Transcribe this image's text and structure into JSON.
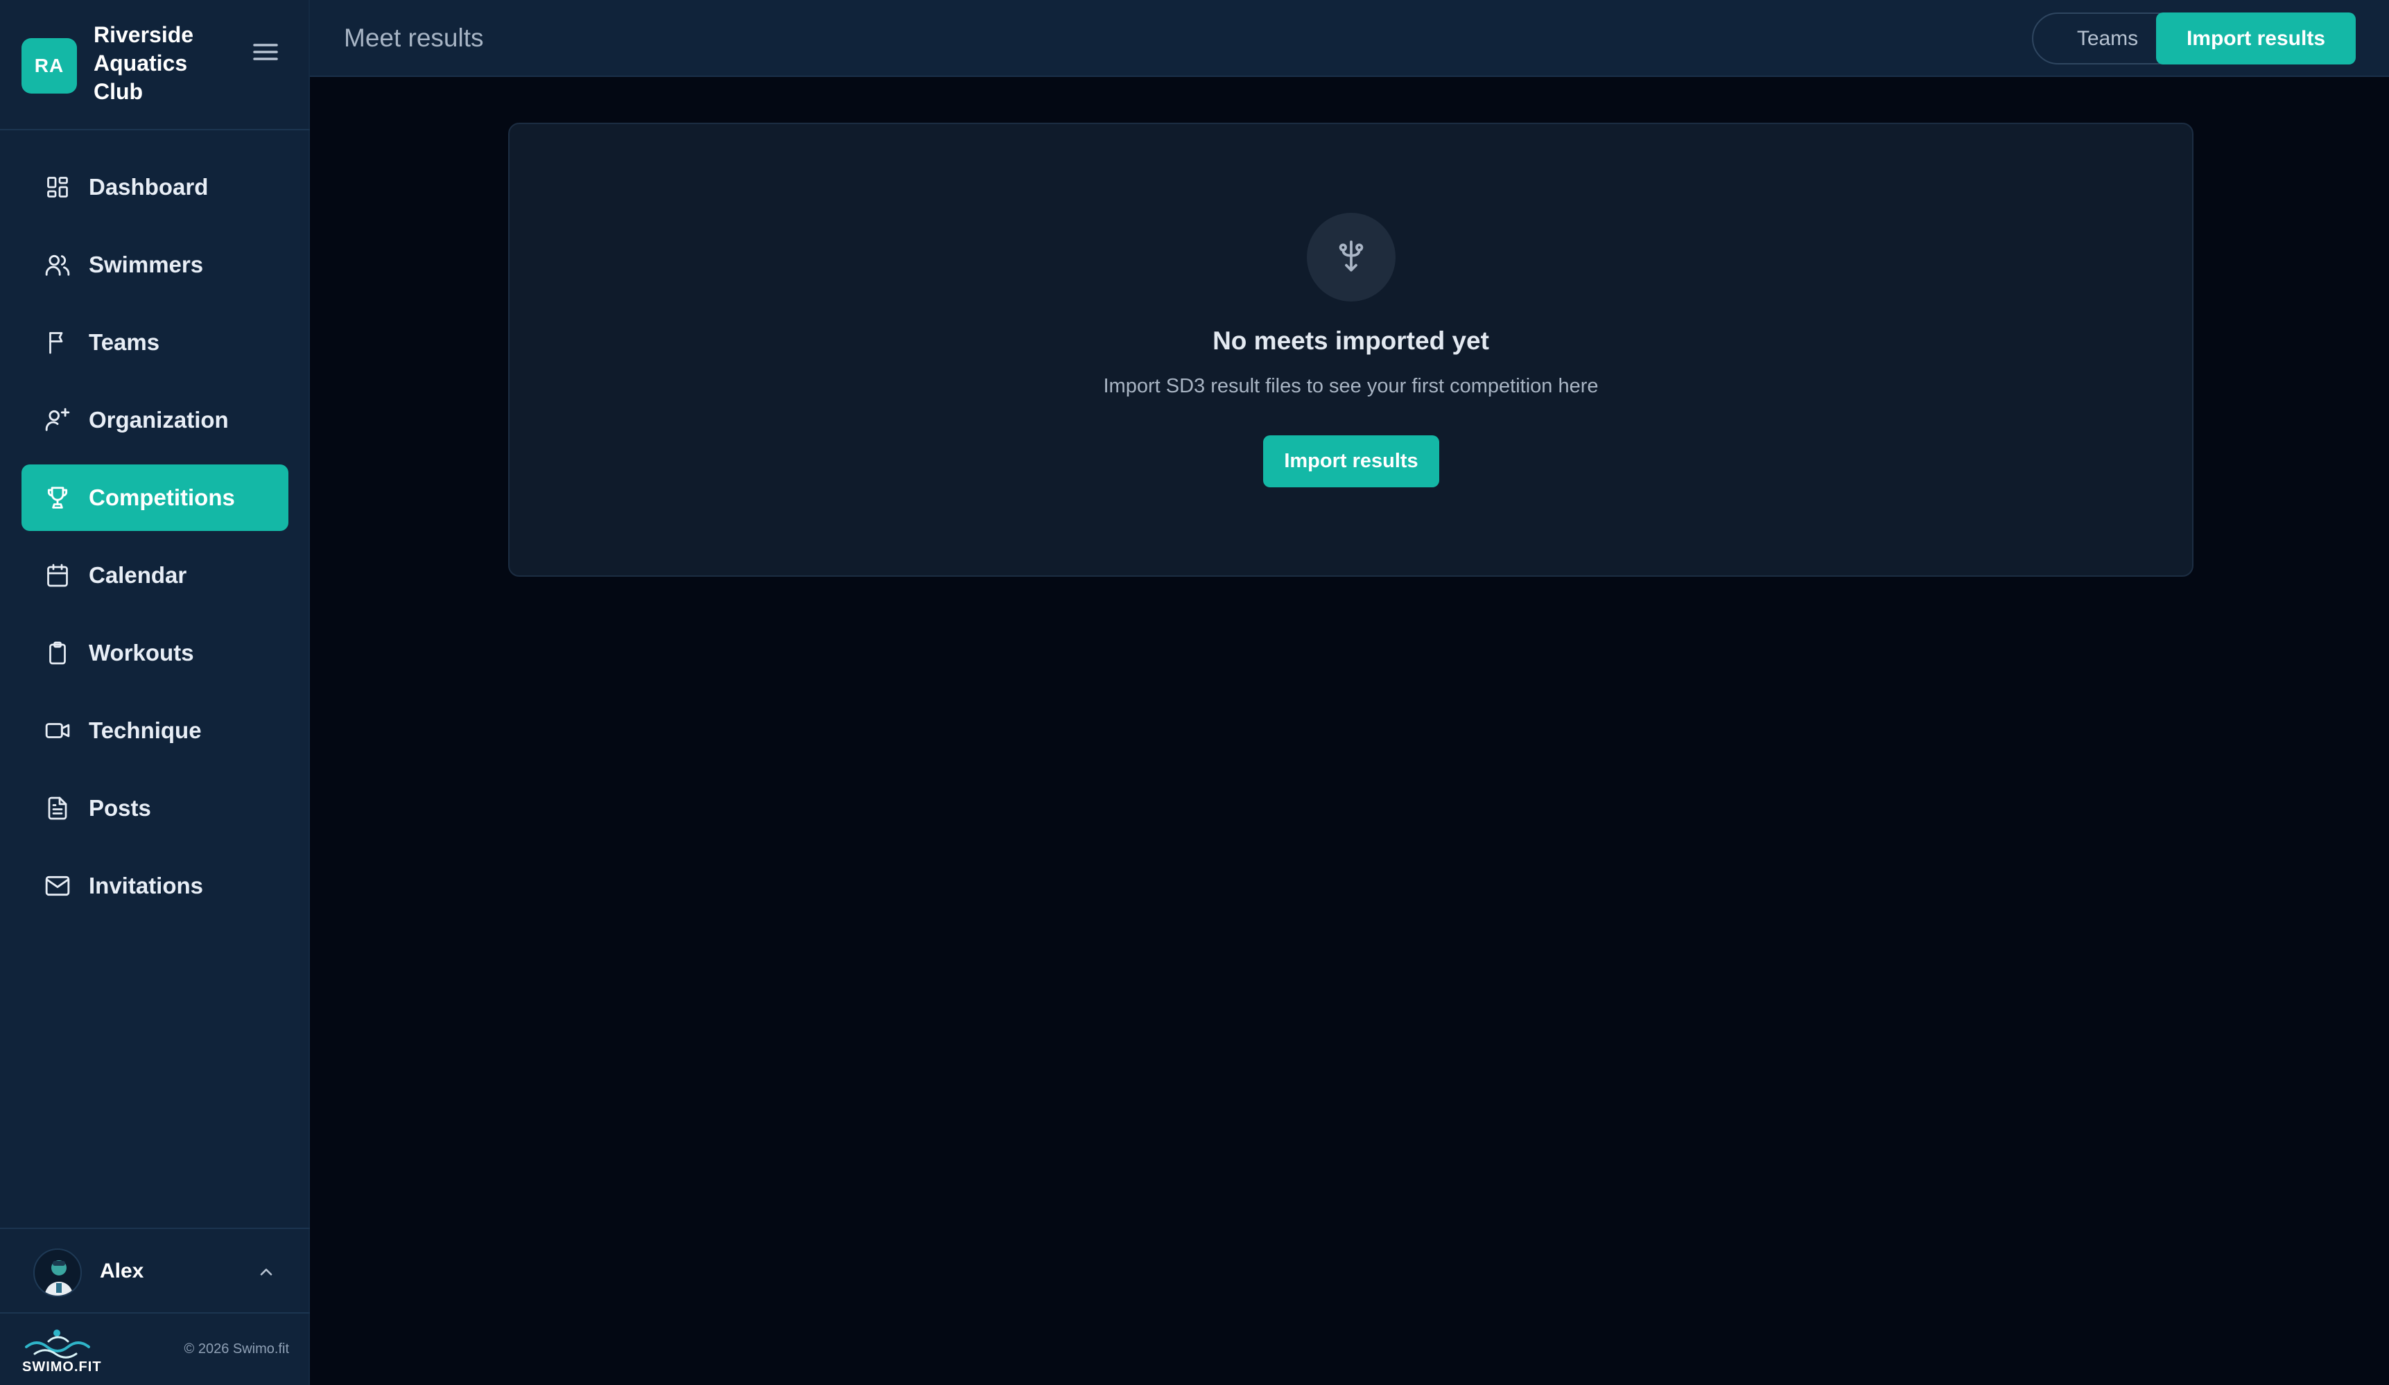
{
  "sidebar": {
    "org": {
      "initials": "RA",
      "name": "Riverside Aquatics Club"
    },
    "nav": [
      {
        "label": "Dashboard",
        "icon": "grid-icon",
        "active": false
      },
      {
        "label": "Swimmers",
        "icon": "users-icon",
        "active": false
      },
      {
        "label": "Teams",
        "icon": "flag-icon",
        "active": false
      },
      {
        "label": "Organization",
        "icon": "user-cog-icon",
        "active": false
      },
      {
        "label": "Competitions",
        "icon": "trophy-icon",
        "active": true
      },
      {
        "label": "Calendar",
        "icon": "calendar-icon",
        "active": false
      },
      {
        "label": "Workouts",
        "icon": "clipboard-icon",
        "active": false
      },
      {
        "label": "Technique",
        "icon": "video-icon",
        "active": false
      },
      {
        "label": "Posts",
        "icon": "document-icon",
        "active": false
      },
      {
        "label": "Invitations",
        "icon": "mail-icon",
        "active": false
      }
    ],
    "user": {
      "name": "Alex"
    },
    "footer": {
      "brand": "SWIMO.FIT",
      "copyright": "© 2026 Swimo.fit"
    }
  },
  "topbar": {
    "title": "Meet results",
    "teams_label": "Teams",
    "import_label": "Import results"
  },
  "empty_state": {
    "icon": "usb-import-icon",
    "title": "No meets imported yet",
    "subtitle": "Import SD3 result files to see your first competition here",
    "button_label": "Import results"
  },
  "colors": {
    "accent": "#14b8a6",
    "sidebar_bg": "#10233a",
    "page_bg": "#030813",
    "card_bg": "#0f1b2b"
  }
}
